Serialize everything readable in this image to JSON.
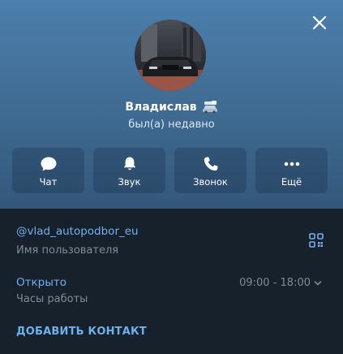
{
  "profile": {
    "name": "Владислав",
    "status": "был(а) недавно"
  },
  "actions": [
    {
      "label": "Чат",
      "icon": "chat-icon"
    },
    {
      "label": "Звук",
      "icon": "bell-icon"
    },
    {
      "label": "Звонок",
      "icon": "phone-icon"
    },
    {
      "label": "Ещё",
      "icon": "more-icon"
    }
  ],
  "info": {
    "username": "@vlad_autopodbor_eu",
    "username_caption": "Имя пользователя",
    "business_status": "Открыто",
    "business_caption": "Часы работы",
    "hours": "09:00 - 18:00",
    "add_contact": "ДОБАВИТЬ КОНТАКТ"
  },
  "colors": {
    "header_top": "#4c7fad",
    "panel_bg": "#17212b",
    "link": "#6fb0ee",
    "muted": "#7f8b97"
  }
}
